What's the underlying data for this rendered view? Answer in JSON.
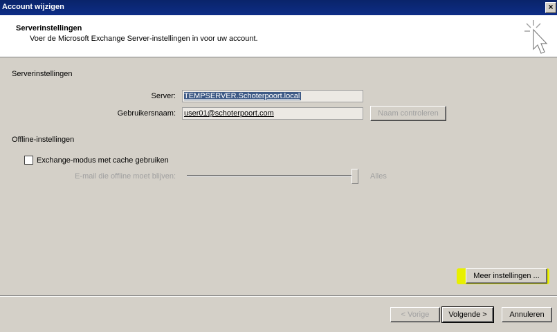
{
  "window": {
    "title": "Account wijzigen",
    "close_label": "×"
  },
  "header": {
    "title": "Serverinstellingen",
    "subtitle": "Voer de Microsoft Exchange Server-instellingen in voor uw account."
  },
  "server_section": {
    "title": "Serverinstellingen",
    "server_label": "Server:",
    "server_value": "TEMPSERVER.Schoterpoort.local",
    "username_label": "Gebruikersnaam:",
    "username_value": "user01@schoterpoort.com",
    "check_name_button": "Naam controleren"
  },
  "offline_section": {
    "title": "Offline-instellingen",
    "cache_checkbox_label": "Exchange-modus met cache gebruiken",
    "cache_checked": false,
    "slider_label": "E-mail die offline moet blijven:",
    "slider_value_label": "Alles",
    "slider_level": 1.0
  },
  "more_settings_button": "Meer instellingen ...",
  "footer": {
    "back_button": "< Vorige",
    "next_button": "Volgende >",
    "cancel_button": "Annuleren"
  },
  "colors": {
    "titlebar": "#0a246a",
    "highlight": "#e8f000",
    "selection": "#3e5a86"
  }
}
